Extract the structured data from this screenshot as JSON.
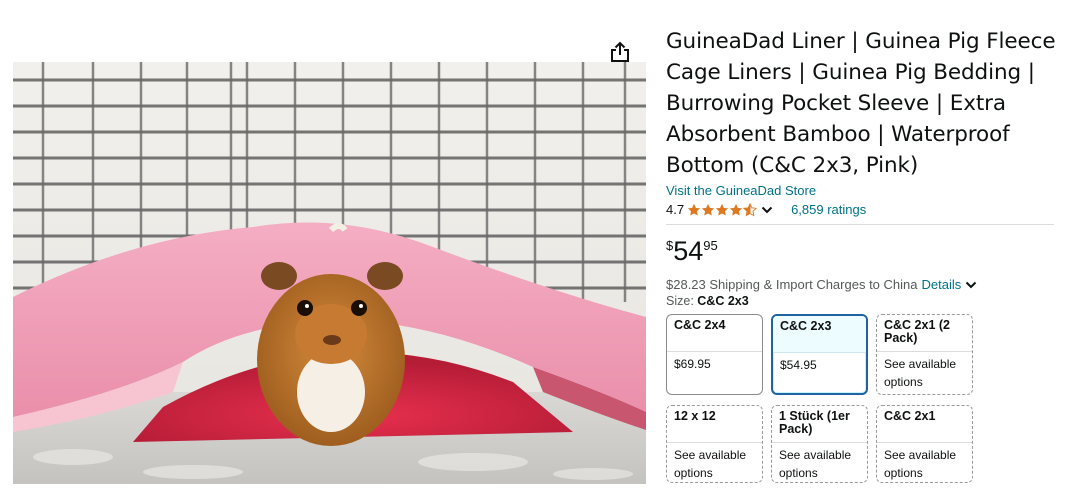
{
  "product": {
    "title": "GuineaDad Liner | Guinea Pig Fleece Cage Liners | Guinea Pig Bedding | Burrowing Pocket Sleeve | Extra Absorbent Bamboo | Waterproof Bottom (C&C 2x3, Pink)",
    "store_link": "Visit the GuineaDad Store",
    "rating_value": "4.7",
    "rating_stars": 4.5,
    "ratings_count": "6,859 ratings",
    "price": {
      "symbol": "$",
      "whole": "54",
      "fraction": "95"
    },
    "shipping_text": "$28.23 Shipping & Import Charges to China",
    "shipping_details": "Details",
    "size_label": "Size: ",
    "size_selected": "C&C 2x3"
  },
  "image": {
    "description_icon": "guinea-pig-photo"
  },
  "icons": {
    "share": "share-icon"
  },
  "colors": {
    "link": "#007185",
    "star": "#de7921",
    "selected_border": "#2162a1"
  },
  "sizes": [
    {
      "name": "C&C 2x4",
      "price": "$69.95",
      "selected": false
    },
    {
      "name": "C&C 2x3",
      "price": "$54.95",
      "selected": true
    },
    {
      "name": "C&C 2x1 (2 Pack)",
      "price": "See available options",
      "selected": false
    },
    {
      "name": "12 x 12",
      "price": "See available options",
      "selected": false
    },
    {
      "name": "1 Stück (1er Pack)",
      "price": "See available options",
      "selected": false
    },
    {
      "name": "C&C 2x1",
      "price": "See available options",
      "selected": false
    }
  ]
}
